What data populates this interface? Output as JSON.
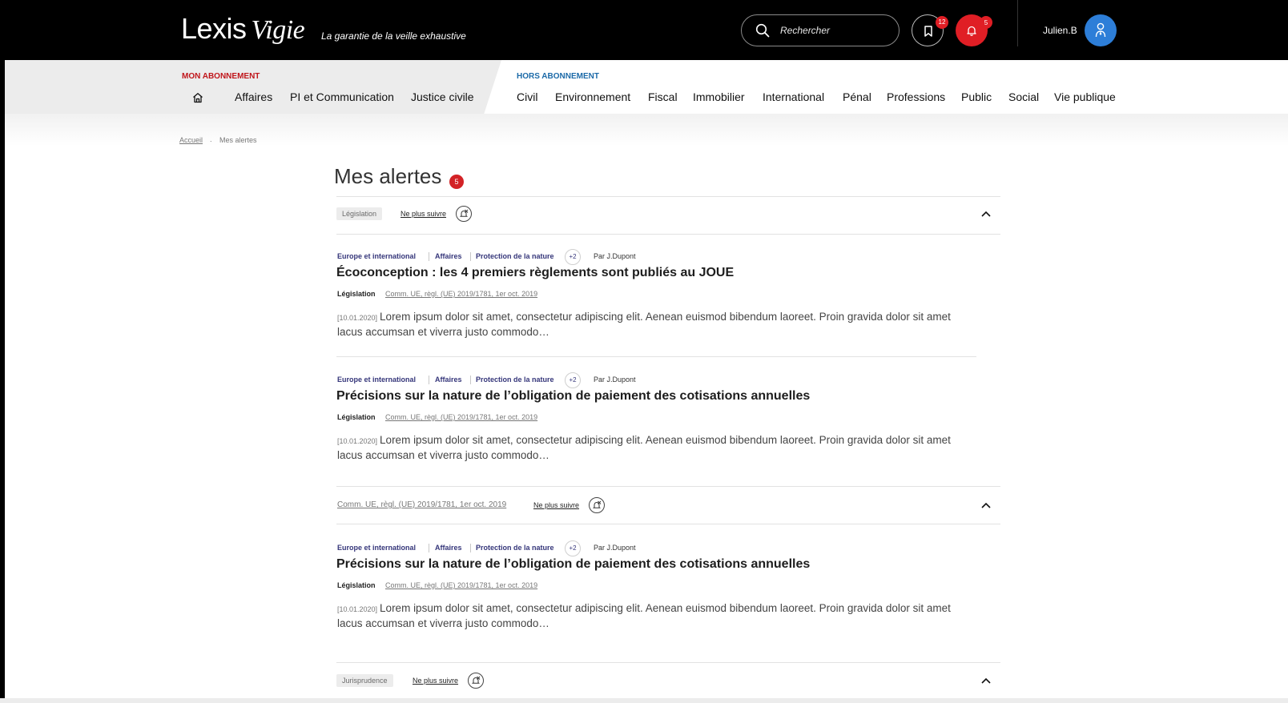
{
  "header": {
    "logo_main": "Lexis",
    "logo_sub": "Vigie",
    "tagline": "La garantie de la veille exhaustive",
    "search_placeholder": "Rechercher",
    "bookmark_count": "12",
    "alert_count": "5",
    "user_name": "Julien.B"
  },
  "nav": {
    "subscribed_label": "MON ABONNEMENT",
    "unsubscribed_label": "HORS ABONNEMENT",
    "subscribed_items": [
      "Affaires",
      "PI et Communication",
      "Justice civile"
    ],
    "unsubscribed_items": [
      "Civil",
      "Environnement",
      "Fiscal",
      "Immobilier",
      "International",
      "Pénal",
      "Professions",
      "Public",
      "Social",
      "Vie publique"
    ]
  },
  "breadcrumb": {
    "home": "Accueil",
    "separator": ".",
    "current": "Mes alertes"
  },
  "page": {
    "title": "Mes alertes",
    "badge": "5"
  },
  "sections": [
    {
      "label": "Législation",
      "unfollow": "Ne plus suivre",
      "articles": [
        {
          "categories": [
            "Europe et international",
            "Affaires",
            "Protection de la nature"
          ],
          "more": "+2",
          "author": "Par J.Dupont",
          "title": "Écoconception : les 4 premiers règlements sont publiés au JOUE",
          "type": "Législation",
          "reference": "Comm. UE, règl. (UE) 2019/1781, 1er oct. 2019",
          "date": "[10.01.2020]",
          "excerpt": "Lorem ipsum dolor sit amet, consectetur adipiscing elit. Aenean euismod bibendum laoreet. Proin gravida dolor sit amet lacus accumsan et viverra justo commodo…"
        },
        {
          "categories": [
            "Europe et international",
            "Affaires",
            "Protection de la nature"
          ],
          "more": "+2",
          "author": "Par J.Dupont",
          "title": "Précisions sur la nature de l’obligation de paiement des cotisations annuelles",
          "type": "Législation",
          "reference": "Comm. UE, règl. (UE) 2019/1781, 1er oct. 2019",
          "date": "[10.01.2020]",
          "excerpt": "Lorem ipsum dolor sit amet, consectetur adipiscing elit. Aenean euismod bibendum laoreet. Proin gravida dolor sit amet lacus accumsan et viverra justo commodo…"
        }
      ]
    },
    {
      "label": "Comm. UE, règl. (UE) 2019/1781, 1er oct. 2019",
      "unfollow": "Ne plus suivre",
      "articles": [
        {
          "categories": [
            "Europe et international",
            "Affaires",
            "Protection de la nature"
          ],
          "more": "+2",
          "author": "Par J.Dupont",
          "title": "Précisions sur la nature de l’obligation de paiement des cotisations annuelles",
          "type": "Législation",
          "reference": "Comm. UE, règl. (UE) 2019/1781, 1er oct. 2019",
          "date": "[10.01.2020]",
          "excerpt": "Lorem ipsum dolor sit amet, consectetur adipiscing elit. Aenean euismod bibendum laoreet. Proin gravida dolor sit amet lacus accumsan et viverra justo commodo…"
        }
      ]
    },
    {
      "label": "Jurisprudence",
      "unfollow": "Ne plus suivre",
      "articles": []
    }
  ],
  "colors": {
    "header_bg": "#000000",
    "alert_red": "#e01e25",
    "avatar_blue": "#2d7ed8",
    "subscribed_red": "#c0161b",
    "unsubscribed_blue": "#1c6aa8",
    "category_navy": "#35367a"
  },
  "icons": [
    "search-icon",
    "bookmark-icon",
    "bell-icon",
    "user-icon",
    "home-icon",
    "bell-off-icon",
    "chevron-up-icon"
  ]
}
